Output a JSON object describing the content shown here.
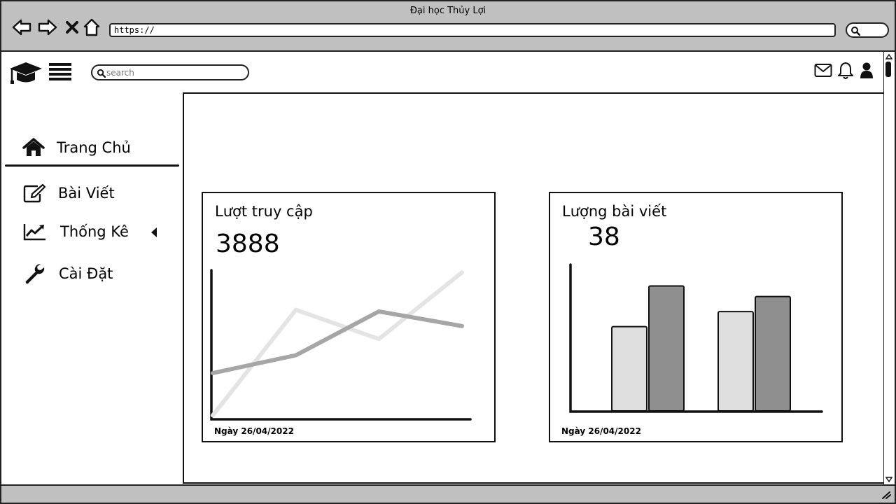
{
  "browser": {
    "window_title": "Đại học Thủy Lợi",
    "url": "https://"
  },
  "header": {
    "search_placeholder": "search"
  },
  "sidebar": {
    "items": [
      {
        "label": "Trang Chủ",
        "icon": "home-icon"
      },
      {
        "label": "Bài Viết",
        "icon": "edit-icon"
      },
      {
        "label": "Thống Kê",
        "icon": "chart-line-icon"
      },
      {
        "label": "Cài Đặt",
        "icon": "wrench-icon"
      }
    ]
  },
  "cards": [
    {
      "title": "Lượt truy cập",
      "value": "3888",
      "date": "Ngày 26/04/2022"
    },
    {
      "title": "Lượng bài viết",
      "value": "38",
      "date": "Ngày 26/04/2022"
    }
  ],
  "colors": {
    "chrome": "#c0c0c0",
    "line_dark": "#a6a6a6",
    "line_light": "#e4e4e4",
    "bar_light": "#dedede",
    "bar_dark": "#8f8f8f"
  },
  "chart_data": [
    {
      "type": "line",
      "title": "",
      "x": [
        1,
        2,
        3,
        4
      ],
      "series": [
        {
          "values": [
            2.8,
            3.9,
            6.6,
            5.7
          ]
        },
        {
          "values": [
            0.2,
            6.7,
            4.9,
            9.0
          ]
        }
      ],
      "ylim": [
        0,
        10
      ],
      "grid": false
    },
    {
      "type": "bar",
      "title": "",
      "categories": [
        "1",
        "2"
      ],
      "series": [
        {
          "values": [
            5.6,
            6.6
          ]
        },
        {
          "values": [
            8.3,
            7.6
          ]
        }
      ],
      "ylim": [
        0,
        10
      ],
      "grid": false
    }
  ]
}
